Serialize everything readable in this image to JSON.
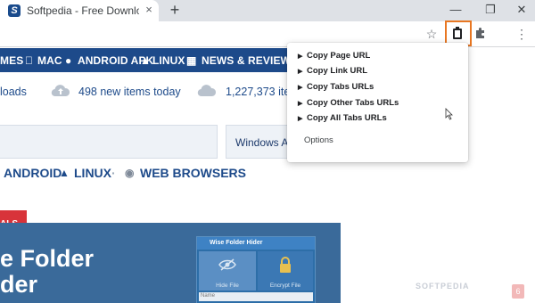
{
  "browser": {
    "tab_title": "Softpedia - Free Downloads Ency",
    "tab_favicon_letter": "S",
    "tab_close": "×",
    "new_tab": "+",
    "window_controls": {
      "minimize": "—",
      "maximize": "❐",
      "close": "✕"
    },
    "toolbar_icons": {
      "bookmark_star": "☆",
      "menu": "⋮"
    }
  },
  "site_nav": {
    "items": [
      "MES",
      "MAC",
      "ANDROID APK",
      "LINUX",
      "NEWS & REVIEWS"
    ]
  },
  "stats": {
    "left_fragment": "loads",
    "new_items": "498 new items today",
    "total_items": "1,227,373 items"
  },
  "search": {
    "select_value": "Windows Apps"
  },
  "categories": {
    "items": [
      "ANDROID",
      "LINUX",
      "WEB BROWSERS"
    ],
    "separator": "·"
  },
  "badge": {
    "label": "ALS"
  },
  "banner": {
    "title_line1": "e Folder",
    "title_line2": "der",
    "app_title": "Wise Folder Hider",
    "tile1_label": "Hide File",
    "tile2_label": "Encrypt File",
    "name_field": "Name"
  },
  "watermark": "SOFTPEDIA",
  "pink_btn": "6",
  "popup_menu": {
    "items": [
      "Copy Page URL",
      "Copy Link URL",
      "Copy Tabs URLs",
      "Copy Other Tabs URLs",
      "Copy All Tabs URLs"
    ],
    "arrow": "▶",
    "options_label": "Options"
  },
  "colors": {
    "brand_blue": "#1d4a8a",
    "highlight_orange": "#e87722",
    "badge_red": "#d8333a"
  }
}
